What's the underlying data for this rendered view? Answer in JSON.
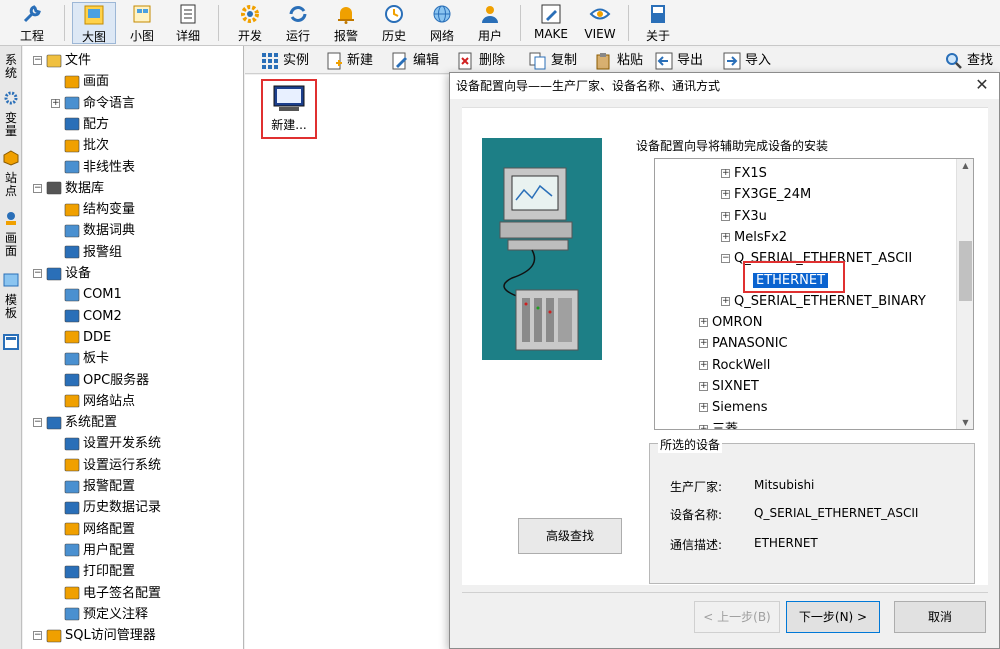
{
  "toolbar": {
    "items": [
      {
        "label": "工程",
        "icon": "wrench-icon"
      },
      {
        "label": "大图",
        "icon": "large-view-icon"
      },
      {
        "label": "小图",
        "icon": "small-view-icon"
      },
      {
        "label": "详细",
        "icon": "detail-view-icon"
      },
      {
        "label": "开发",
        "icon": "gear-icon"
      },
      {
        "label": "运行",
        "icon": "run-icon"
      },
      {
        "label": "报警",
        "icon": "bell-icon"
      },
      {
        "label": "历史",
        "icon": "clock-icon"
      },
      {
        "label": "网络",
        "icon": "globe-icon"
      },
      {
        "label": "用户",
        "icon": "user-icon"
      },
      {
        "label": "MAKE",
        "icon": "pencil-icon"
      },
      {
        "label": "VIEW",
        "icon": "eye-icon"
      },
      {
        "label": "关于",
        "icon": "book-icon"
      }
    ]
  },
  "vtabs": [
    {
      "label": "系统",
      "icon": "gear-icon"
    },
    {
      "label": "变量",
      "icon": "cube-icon"
    },
    {
      "label": "站点",
      "icon": "station-icon"
    },
    {
      "label": "画面",
      "icon": "image-icon"
    },
    {
      "label": "模板",
      "icon": "template-icon"
    }
  ],
  "tree": {
    "nodes": [
      {
        "label": "文件",
        "icon": "folder-icon",
        "level": 0,
        "exp": "−"
      },
      {
        "label": "画面",
        "icon": "picture-icon",
        "level": 1,
        "exp": ""
      },
      {
        "label": "命令语言",
        "icon": "terminal-icon",
        "level": 1,
        "exp": "+"
      },
      {
        "label": "配方",
        "icon": "recipe-icon",
        "level": 1,
        "exp": ""
      },
      {
        "label": "批次",
        "icon": "document-icon",
        "level": 1,
        "exp": ""
      },
      {
        "label": "非线性表",
        "icon": "chart-icon",
        "level": 1,
        "exp": ""
      },
      {
        "label": "数据库",
        "icon": "database-icon",
        "level": 0,
        "exp": "−"
      },
      {
        "label": "结构变量",
        "icon": "structure-icon",
        "level": 1,
        "exp": ""
      },
      {
        "label": "数据词典",
        "icon": "dictionary-icon",
        "level": 1,
        "exp": ""
      },
      {
        "label": "报警组",
        "icon": "alarm-group-icon",
        "level": 1,
        "exp": ""
      },
      {
        "label": "设备",
        "icon": "monitor-icon",
        "level": 0,
        "exp": "−"
      },
      {
        "label": "COM1",
        "icon": "serial-port-icon",
        "level": 1,
        "exp": ""
      },
      {
        "label": "COM2",
        "icon": "serial-port-icon",
        "level": 1,
        "exp": ""
      },
      {
        "label": "DDE",
        "icon": "dde-icon",
        "level": 1,
        "exp": ""
      },
      {
        "label": "板卡",
        "icon": "card-icon",
        "level": 1,
        "exp": ""
      },
      {
        "label": "OPC服务器",
        "icon": "opc-icon",
        "level": 1,
        "exp": ""
      },
      {
        "label": "网络站点",
        "icon": "network-icon",
        "level": 1,
        "exp": ""
      },
      {
        "label": "系统配置",
        "icon": "settings-icon",
        "level": 0,
        "exp": "−"
      },
      {
        "label": "设置开发系统",
        "icon": "gear-icon",
        "level": 1,
        "exp": ""
      },
      {
        "label": "设置运行系统",
        "icon": "run-icon",
        "level": 1,
        "exp": ""
      },
      {
        "label": "报警配置",
        "icon": "bell-icon",
        "level": 1,
        "exp": ""
      },
      {
        "label": "历史数据记录",
        "icon": "clock-icon",
        "level": 1,
        "exp": ""
      },
      {
        "label": "网络配置",
        "icon": "globe-icon",
        "level": 1,
        "exp": ""
      },
      {
        "label": "用户配置",
        "icon": "user-icon",
        "level": 1,
        "exp": ""
      },
      {
        "label": "打印配置",
        "icon": "printer-icon",
        "level": 1,
        "exp": ""
      },
      {
        "label": "电子签名配置",
        "icon": "signature-icon",
        "level": 1,
        "exp": ""
      },
      {
        "label": "预定义注释",
        "icon": "note-icon",
        "level": 1,
        "exp": ""
      },
      {
        "label": "SQL访问管理器",
        "icon": "sql-icon",
        "level": 0,
        "exp": "−"
      }
    ]
  },
  "content_toolbar": {
    "items": [
      {
        "label": "实例",
        "icon": "instance-icon"
      },
      {
        "label": "新建",
        "icon": "new-icon"
      },
      {
        "label": "编辑",
        "icon": "edit-icon"
      },
      {
        "label": "删除",
        "icon": "delete-icon"
      },
      {
        "label": "复制",
        "icon": "copy-icon"
      },
      {
        "label": "粘贴",
        "icon": "paste-icon"
      },
      {
        "label": "导出",
        "icon": "export-icon"
      },
      {
        "label": "导入",
        "icon": "import-icon"
      }
    ],
    "search_label": "查找"
  },
  "content": {
    "new_item_label": "新建..."
  },
  "dialog": {
    "title": "设备配置向导——生产厂家、设备名称、通讯方式",
    "intro": "设备配置向导将辅助完成设备的安装",
    "device_tree": [
      {
        "label": "FX1S",
        "indent": 1,
        "exp": "+"
      },
      {
        "label": "FX3GE_24M",
        "indent": 1,
        "exp": "+"
      },
      {
        "label": "FX3u",
        "indent": 1,
        "exp": "+"
      },
      {
        "label": "MelsFx2",
        "indent": 1,
        "exp": "+"
      },
      {
        "label": "Q_SERIAL_ETHERNET_ASCII",
        "indent": 1,
        "exp": "−"
      },
      {
        "label": "ETHERNET",
        "indent": 2,
        "exp": "",
        "selected": true
      },
      {
        "label": "Q_SERIAL_ETHERNET_BINARY",
        "indent": 1,
        "exp": "+"
      },
      {
        "label": "OMRON",
        "indent": 0,
        "exp": "+"
      },
      {
        "label": "PANASONIC",
        "indent": 0,
        "exp": "+"
      },
      {
        "label": "RockWell",
        "indent": 0,
        "exp": "+"
      },
      {
        "label": "SIXNET",
        "indent": 0,
        "exp": "+"
      },
      {
        "label": "Siemens",
        "indent": 0,
        "exp": "+"
      },
      {
        "label": "三菱",
        "indent": 0,
        "exp": "+"
      }
    ],
    "selected_group": {
      "caption": "所选的设备",
      "manufacturer_label": "生产厂家:",
      "manufacturer_value": "Mitsubishi",
      "device_label": "设备名称:",
      "device_value": "Q_SERIAL_ETHERNET_ASCII",
      "comm_label": "通信描述:",
      "comm_value": "ETHERNET"
    },
    "advanced_search": "高级查找",
    "prev_label": "< 上一步(B)",
    "next_label": "下一步(N) >",
    "cancel_label": "取消"
  }
}
